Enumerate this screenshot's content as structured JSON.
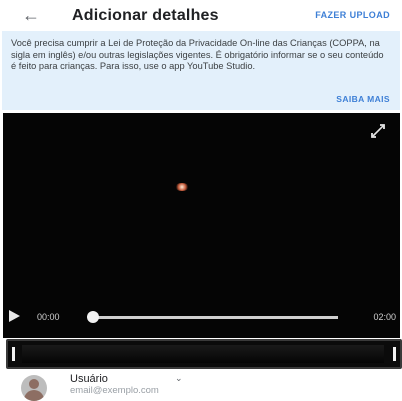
{
  "header": {
    "back_icon": "arrow-left-icon",
    "title": "Adicionar detalhes",
    "upload_label": "FAZER UPLOAD"
  },
  "notice": {
    "text": "Você precisa cumprir a Lei de Proteção da Privacidade On-line das Crianças (COPPA, na sigla em inglês) e/ou outras legislações vigentes. É obrigatório informar se o seu conteúdo é feito para crianças. Para isso, use o app YouTube Studio.",
    "learn_more": "SAIBA MAIS",
    "background": "#e3f0fb",
    "link_color": "#3d7fd6"
  },
  "player": {
    "current_time": "00:00",
    "duration": "02:00",
    "progress": 0,
    "fullscreen_icon": "fullscreen-icon",
    "play_icon": "play-icon"
  },
  "account": {
    "name": "Usuário",
    "email": "email@exemplo.com",
    "dropdown_icon": "chevron-down-icon"
  }
}
